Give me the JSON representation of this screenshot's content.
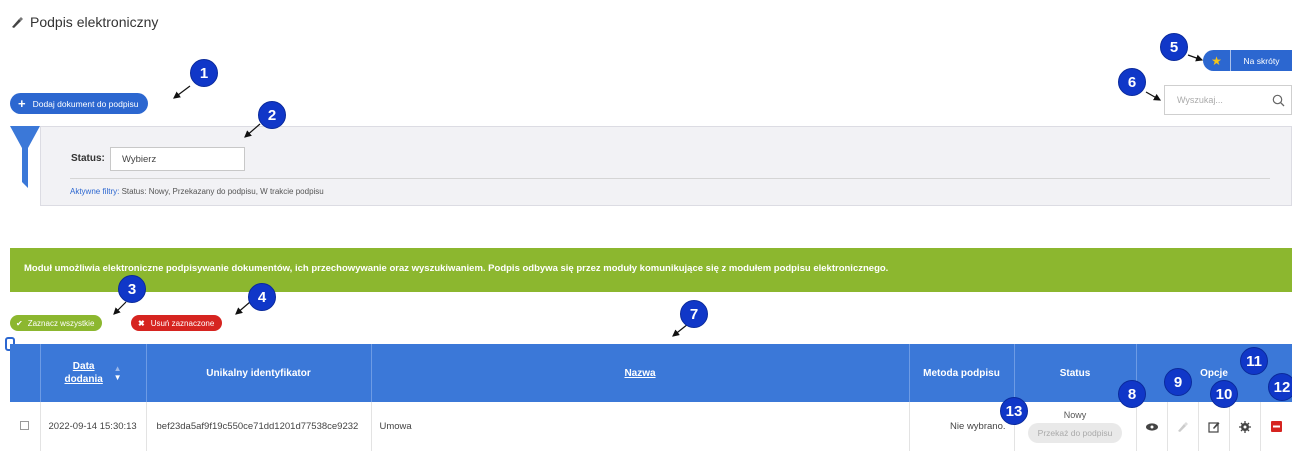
{
  "page": {
    "title": "Podpis elektroniczny",
    "title_icon": "pen-nib-icon"
  },
  "toolbar": {
    "add_document_label": "Dodaj dokument do podpisu"
  },
  "shortcuts": {
    "label": "Na skróty",
    "icon": "star-icon",
    "icon_color": "#f5c518"
  },
  "search": {
    "placeholder": "Wyszukaj..."
  },
  "filter": {
    "status_label": "Status:",
    "status_value": "Wybierz",
    "active_filters_label": "Aktywne filtry:",
    "active_filters_value": "Status: Nowy, Przekazany do podpisu, W trakcie podpisu"
  },
  "info_bar": {
    "text": "Moduł umożliwia elektroniczne podpisywanie dokumentów, ich przechowywanie oraz wyszukiwaniem. Podpis odbywa się przez moduły komunikujące się z modułem podpisu elektronicznego.",
    "color": "#8cb72f"
  },
  "bulk_actions": {
    "select_all_label": "Zaznacz wszystkie",
    "remove_selected_label": "Usuń zaznaczone"
  },
  "table": {
    "columns": {
      "date_line1": "Data",
      "date_line2": "dodania",
      "identifier": "Unikalny identyfikator",
      "name": "Nazwa",
      "method": "Metoda podpisu",
      "status": "Status",
      "options": "Opcje"
    },
    "rows": [
      {
        "date": "2022-09-14 15:30:13",
        "identifier": "bef23da5af9f19c550ce71dd1201d77538ce9232",
        "name": "Umowa",
        "method": "Nie wybrano.",
        "status": "Nowy",
        "forward_label": "Przekaż do podpisu"
      }
    ]
  },
  "markers": [
    "1",
    "2",
    "3",
    "4",
    "5",
    "6",
    "7",
    "8",
    "9",
    "10",
    "11",
    "12",
    "13"
  ],
  "colors": {
    "primary": "#2c67d0",
    "header": "#3b78d8",
    "danger": "#d62420",
    "marker": "#1037c8"
  }
}
